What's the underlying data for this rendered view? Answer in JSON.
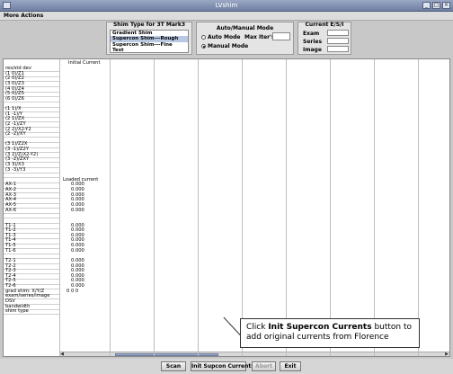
{
  "window": {
    "title": "LVshim"
  },
  "menu": {
    "more_actions": "More Actions"
  },
  "shim_type": {
    "title": "Shim Type for 3T Mark3",
    "items": [
      "Gradient Shim",
      "Supercon Shim---Rough",
      "Supercon Shim---Fine",
      "Test"
    ],
    "selected_index": 1
  },
  "mode": {
    "title": "Auto/Manual Mode",
    "auto_label": "Auto Mode",
    "manual_label": "Manual Mode",
    "max_iter_label": "Max Iter's:",
    "max_iter_value": "",
    "selected": "manual"
  },
  "current_esi": {
    "title": "Current E/S/I",
    "exam_label": "Exam",
    "series_label": "Series",
    "image_label": "Image",
    "exam_value": "",
    "series_value": "",
    "image_value": ""
  },
  "grid": {
    "col_initial_current": "Initial Current",
    "col_loaded_current": "Loaded current",
    "row_labels": [
      "res/std dev",
      "(1 0)/Z1",
      "(2 0)/Z2",
      "(3 0)/Z3",
      "(4 0)/Z4",
      "(5 0)/Z5",
      "(6 0)/Z6",
      "",
      "(1 1)/X",
      "(1 -1)/Y",
      "(2 1)/ZX",
      "(2 -1)/ZY",
      "(2 2)/X2-Y2",
      "(2 -2)/XY",
      "",
      "(3 1)/Z2X",
      "(3 -1)/Z2Y",
      "(3 2)/Z(X2-Y2)",
      "(3 -2)/ZXY",
      "(3 3)/X3",
      "(3 -3)/Y3",
      "",
      "",
      "AX-1",
      "AX-2",
      "AX-3",
      "AX-4",
      "AX-5",
      "AX-6",
      "",
      "",
      "T1-1",
      "T1-2",
      "T1-3",
      "T1-4",
      "T1-5",
      "T1-6",
      "",
      "T2-1",
      "T2-2",
      "T2-3",
      "T2-4",
      "T2-5",
      "T2-6",
      "grad shim: X/Y/Z",
      "exam/series/image",
      "DSV",
      "bandwidth",
      "shim type"
    ],
    "loaded_values": {
      "AX-1": "0.000",
      "AX-2": "0.000",
      "AX-3": "0.000",
      "AX-4": "0.000",
      "AX-5": "0.000",
      "AX-6": "0.000",
      "T1-1": "0.000",
      "T1-2": "0.000",
      "T1-3": "0.000",
      "T1-4": "0.000",
      "T1-5": "0.000",
      "T1-6": "0.000",
      "T2-1": "0.000",
      "T2-2": "0.000",
      "T2-3": "0.000",
      "T2-4": "0.000",
      "T2-5": "0.000",
      "T2-6": "0.000",
      "grad shim: X/Y/Z": "0    0    0"
    }
  },
  "buttons": {
    "scan": "Scan",
    "init_supcon": "Init Supcon Currents",
    "abort": "Abort",
    "exit": "Exit"
  },
  "callout": {
    "prefix": "Click ",
    "bold": "Init Supercon Currents",
    "suffix": " button  to add original currents from Florence"
  },
  "colors": {
    "title_bar": "#7d8cab",
    "selection": "#b8c8e2"
  }
}
